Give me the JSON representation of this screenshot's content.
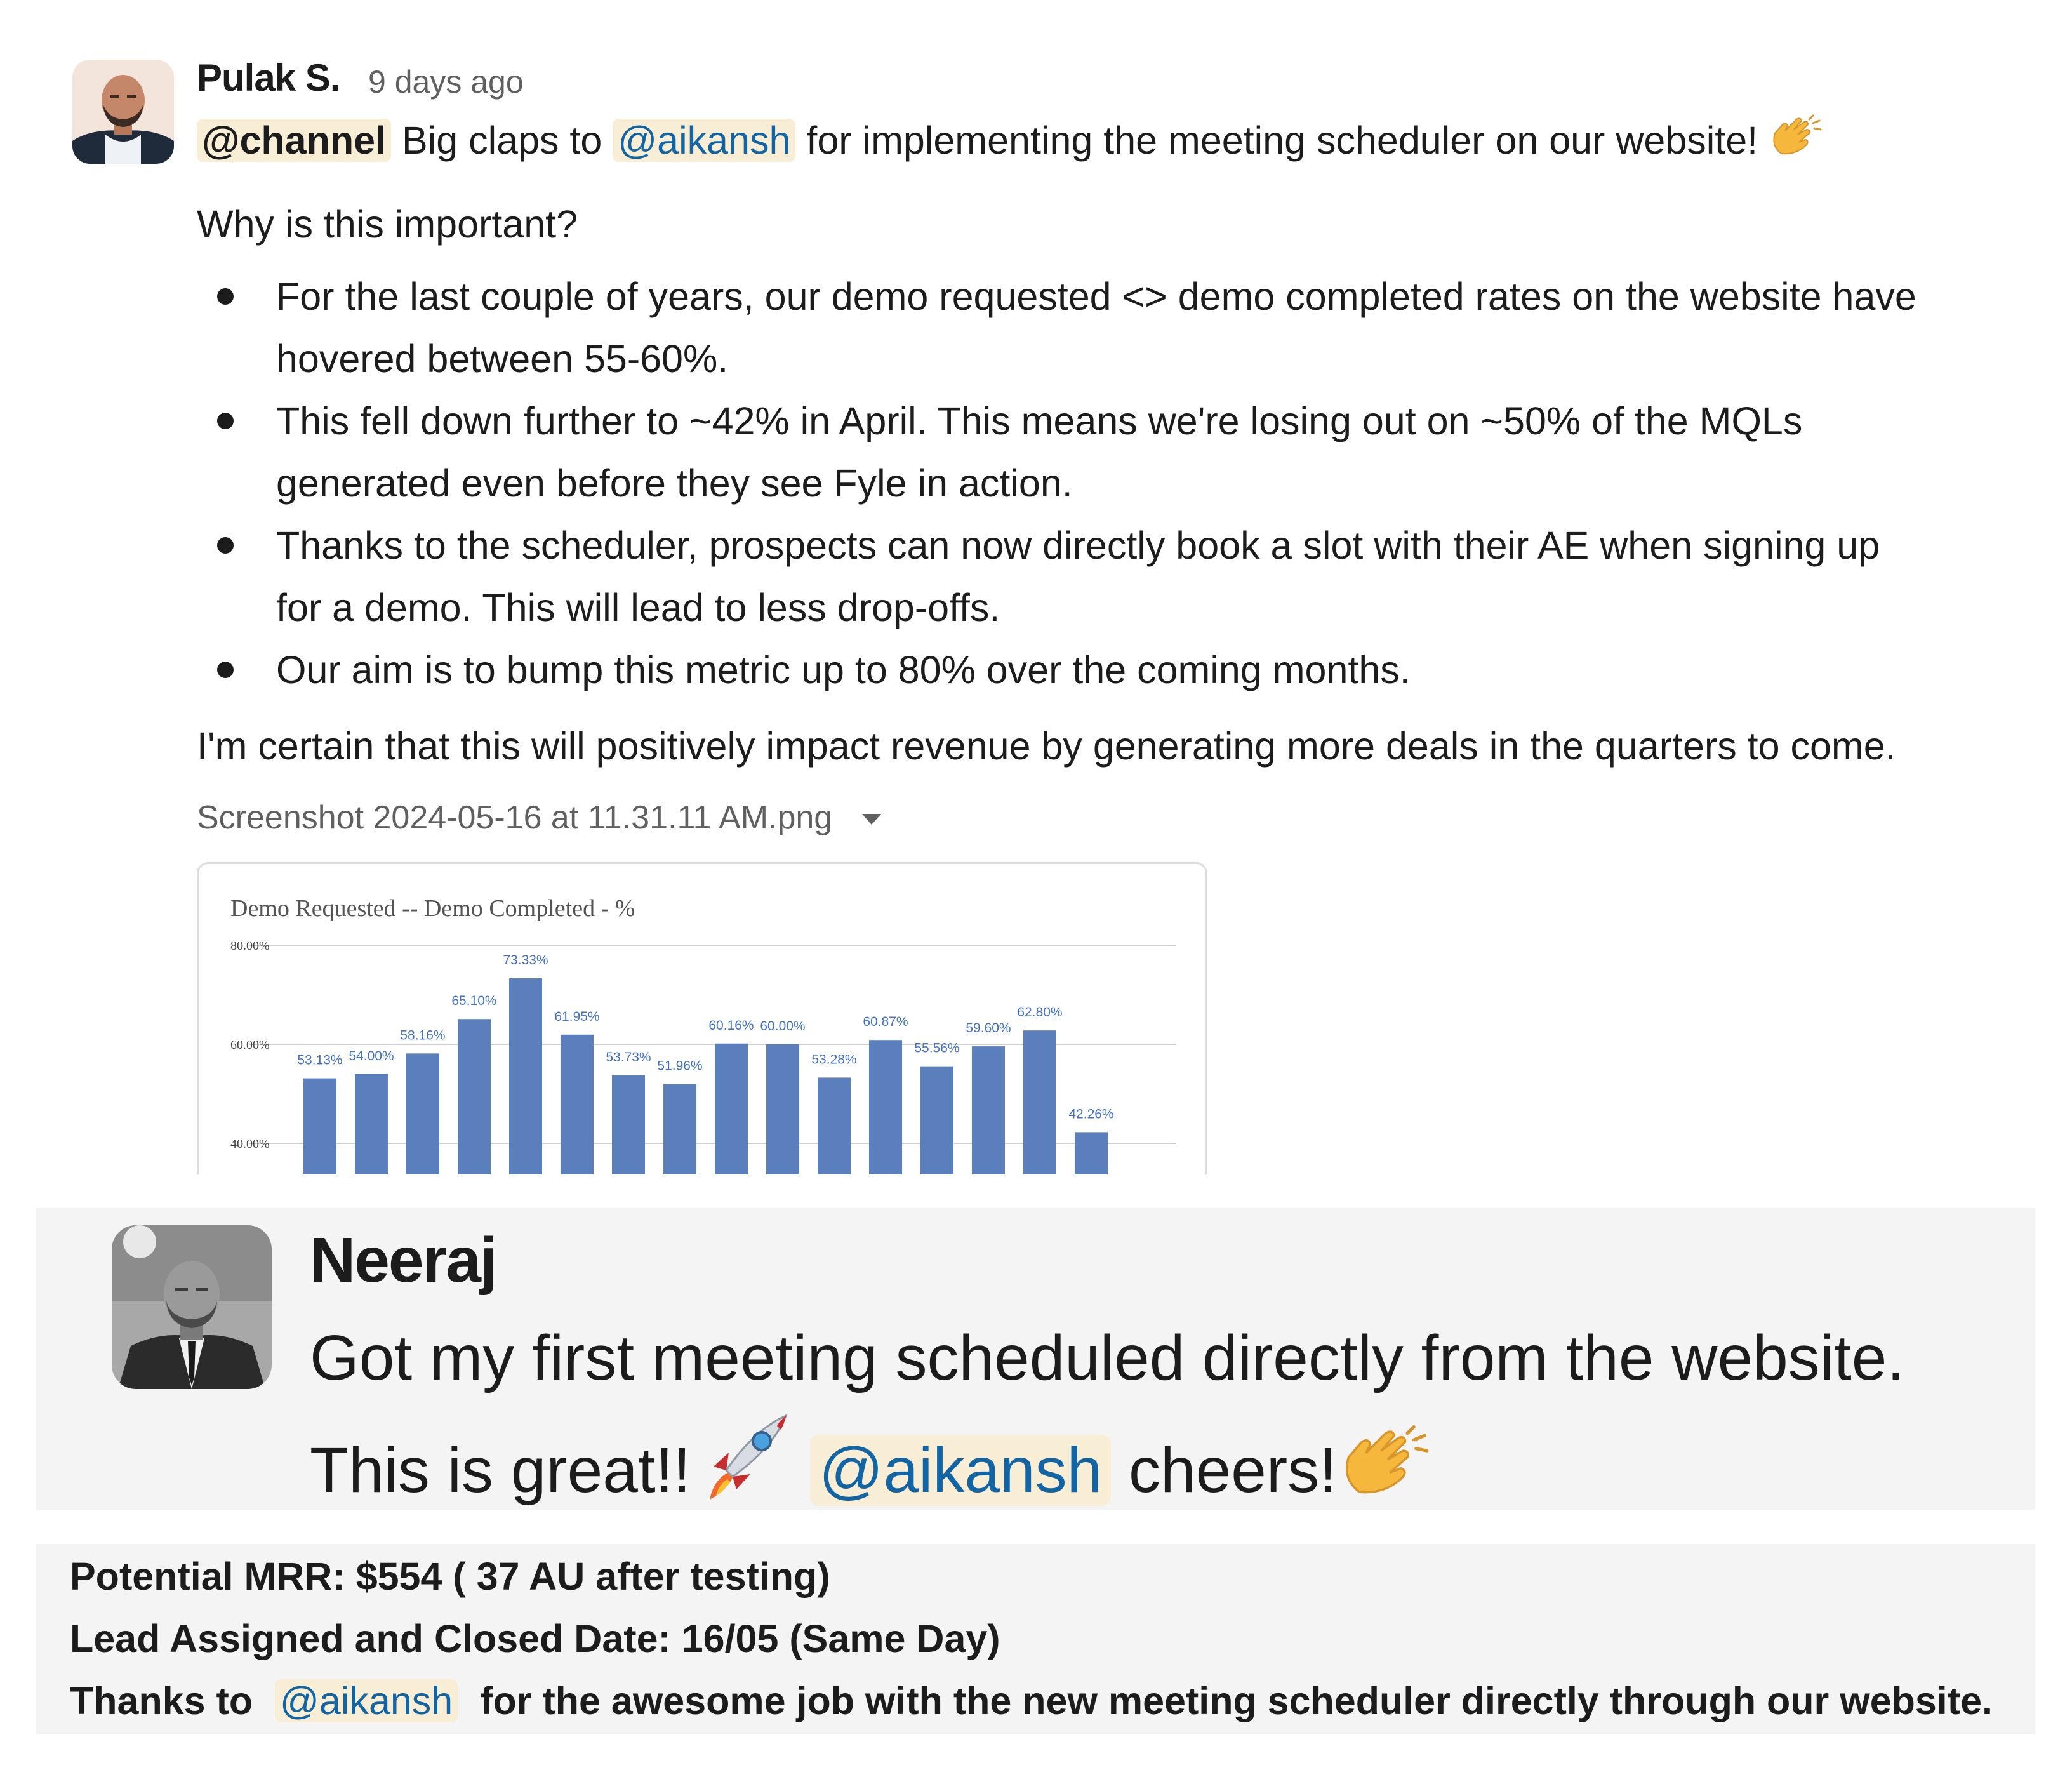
{
  "message1": {
    "author": "Pulak S.",
    "timestamp": "9 days ago",
    "channel_mention": "@channel",
    "intro_part1": "Big claps to",
    "user_mention": "@aikansh",
    "intro_part2": "for implementing the meeting scheduler on our website!",
    "question": "Why is this important?",
    "bullets": [
      {
        "line1": "For the last couple of years, our demo requested <> demo completed rates on the website have",
        "line2": "hovered between 55-60%."
      },
      {
        "line1": "This fell down further to ~42% in April. This means we're losing out on ~50% of the MQLs",
        "line2": "generated even before they see Fyle in action."
      },
      {
        "line1": "Thanks to the scheduler, prospects can now directly book a slot with their AE when signing up",
        "line2": "for a demo. This will lead to less drop-offs."
      },
      {
        "line1": "Our aim is to bump this metric up to 80% over the coming months.",
        "line2": ""
      }
    ],
    "closing": "I'm certain that this will positively impact revenue by generating more deals in the quarters to come.",
    "file_name": "Screenshot 2024-05-16 at 11.31.11 AM.png"
  },
  "chart_data": {
    "type": "bar",
    "title": "Demo Requested -- Demo Completed - %",
    "yticks": [
      "80.00%",
      "60.00%",
      "40.00%"
    ],
    "ylim": [
      40,
      80
    ],
    "values": [
      53.13,
      54.0,
      58.16,
      65.1,
      73.33,
      61.95,
      53.73,
      51.96,
      60.16,
      60.0,
      53.28,
      60.87,
      55.56,
      59.6,
      62.8,
      42.26
    ],
    "labels": [
      "53.13%",
      "54.00%",
      "58.16%",
      "65.10%",
      "73.33%",
      "61.95%",
      "53.73%",
      "51.96%",
      "60.16%",
      "60.00%",
      "53.28%",
      "60.87%",
      "55.56%",
      "59.60%",
      "62.80%",
      "42.26%"
    ],
    "bar_color": "#5b7fbd",
    "grid": true
  },
  "message2": {
    "author": "Neeraj",
    "line1": "Got my first meeting scheduled directly from the website.",
    "line2_start": "This is great!!",
    "user_mention": "@aikansh",
    "line2_end": "cheers!"
  },
  "message3": {
    "mrr": "Potential MRR: $554 ( 37 AU after testing)",
    "lead": "Lead Assigned and Closed Date: 16/05 (Same Day)",
    "thanks_start": "Thanks to",
    "user_mention": "@aikansh",
    "thanks_end": "for the awesome job with the new meeting scheduler directly through our website."
  },
  "colors": {
    "mention_bg": "#f8eed6",
    "mention_text": "#1264a3",
    "panel_bg": "#f4f4f4"
  },
  "icons": {
    "clap": "clapping-hands-icon",
    "rocket": "rocket-icon",
    "caret": "chevron-down-icon"
  }
}
